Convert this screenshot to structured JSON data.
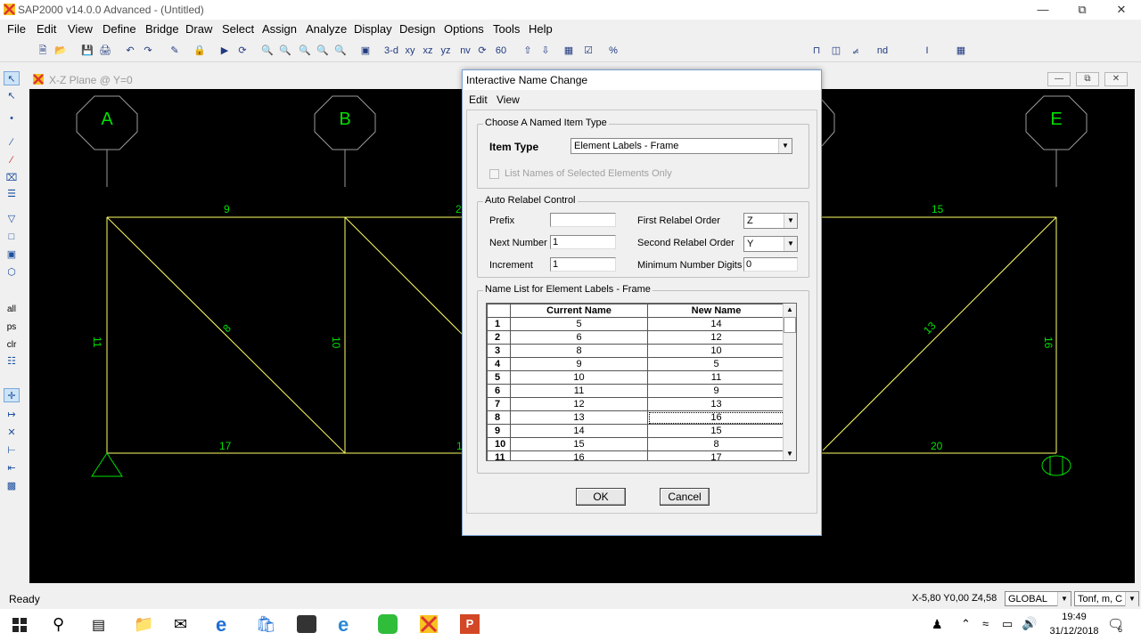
{
  "app": {
    "title": "SAP2000 v14.0.0 Advanced  - (Untitled)"
  },
  "menu": [
    "File",
    "Edit",
    "View",
    "Define",
    "Bridge",
    "Draw",
    "Select",
    "Assign",
    "Analyze",
    "Display",
    "Design",
    "Options",
    "Tools",
    "Help"
  ],
  "toolbar": {
    "view_3d": "3-d",
    "view_xy": "xy",
    "view_xz": "xz",
    "view_yz": "yz",
    "view_nv": "nv",
    "view_60": "60",
    "nd_label": "nd"
  },
  "lefttoolbar": {
    "all": "all",
    "ps": "ps",
    "clr": "clr"
  },
  "child_window": {
    "title": "X-Z Plane @ Y=0"
  },
  "structure": {
    "grid_labels": [
      "A",
      "B",
      "E"
    ],
    "frame_labels": [
      "9",
      "2",
      "15",
      "8",
      "10",
      "13",
      "16",
      "11",
      "17",
      "1",
      "20"
    ]
  },
  "dialog": {
    "title": "Interactive Name Change",
    "menu": [
      "Edit",
      "View"
    ],
    "choose_group": "Choose A Named Item Type",
    "item_type_label": "Item Type",
    "item_type_value": "Element Labels - Frame",
    "list_selected_only": "List Names of Selected Elements Only",
    "auto_group": "Auto Relabel Control",
    "prefix_label": "Prefix",
    "prefix_value": "",
    "next_number_label": "Next Number",
    "next_number_value": "1",
    "increment_label": "Increment",
    "increment_value": "1",
    "first_order_label": "First Relabel Order",
    "first_order_value": "Z",
    "second_order_label": "Second Relabel Order",
    "second_order_value": "Y",
    "min_digits_label": "Minimum Number Digits",
    "min_digits_value": "0",
    "list_group": "Name List for Element Labels - Frame",
    "columns": [
      "Current Name",
      "New Name"
    ],
    "rows": [
      {
        "n": "1",
        "cur": "5",
        "new": "14"
      },
      {
        "n": "2",
        "cur": "6",
        "new": "12"
      },
      {
        "n": "3",
        "cur": "8",
        "new": "10"
      },
      {
        "n": "4",
        "cur": "9",
        "new": "5"
      },
      {
        "n": "5",
        "cur": "10",
        "new": "11"
      },
      {
        "n": "6",
        "cur": "11",
        "new": "9"
      },
      {
        "n": "7",
        "cur": "12",
        "new": "13"
      },
      {
        "n": "8",
        "cur": "13",
        "new": "16"
      },
      {
        "n": "9",
        "cur": "14",
        "new": "15"
      },
      {
        "n": "10",
        "cur": "15",
        "new": "8"
      },
      {
        "n": "11",
        "cur": "16",
        "new": "17"
      }
    ],
    "ok": "OK",
    "cancel": "Cancel"
  },
  "status": {
    "ready": "Ready",
    "coords": "X-5,80  Y0,00  Z4,58",
    "coord_system": "GLOBAL",
    "units": "Tonf, m, C"
  },
  "taskbar": {
    "time": "19:49",
    "date": "31/12/2018",
    "notifications": "6"
  },
  "colors": {
    "background": "#000000",
    "frame": "#ffff66",
    "labels": "#00e000",
    "dialog_border": "#7aa0d0"
  }
}
